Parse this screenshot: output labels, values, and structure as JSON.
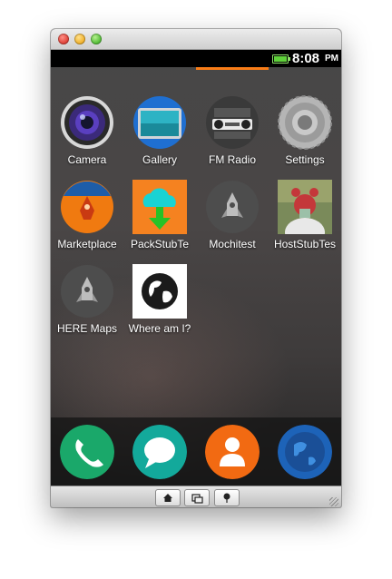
{
  "status_bar": {
    "time": "8:08",
    "ampm": "PM",
    "battery_color": "#5fd23a",
    "page_indicator_color": "#f97c17"
  },
  "apps": [
    {
      "label": "Camera",
      "icon": "camera-icon"
    },
    {
      "label": "Gallery",
      "icon": "gallery-icon"
    },
    {
      "label": "FM Radio",
      "icon": "fm-radio-icon"
    },
    {
      "label": "Settings",
      "icon": "settings-gear-icon"
    },
    {
      "label": "Marketplace",
      "icon": "marketplace-rocket-icon"
    },
    {
      "label": "PackStubTe",
      "icon": "cloud-download-icon"
    },
    {
      "label": "Mochitest",
      "icon": "rocket-icon"
    },
    {
      "label": "HostStubTes",
      "icon": "photo-person-icon"
    },
    {
      "label": "HERE Maps",
      "icon": "rocket-icon"
    },
    {
      "label": "Where am I?",
      "icon": "globe-icon"
    }
  ],
  "dock": [
    {
      "name": "phone",
      "icon": "phone-icon",
      "color": "#1aa86a"
    },
    {
      "name": "messages",
      "icon": "messages-icon",
      "color": "#13a99b"
    },
    {
      "name": "contacts",
      "icon": "contacts-icon",
      "color": "#f26a12"
    },
    {
      "name": "browser",
      "icon": "browser-globe-icon",
      "color": "#1d63b8"
    }
  ],
  "bottom_bar": {
    "buttons": [
      {
        "name": "home",
        "icon": "home-icon"
      },
      {
        "name": "windows",
        "icon": "windows-icon"
      },
      {
        "name": "location",
        "icon": "location-pin-icon"
      }
    ]
  }
}
